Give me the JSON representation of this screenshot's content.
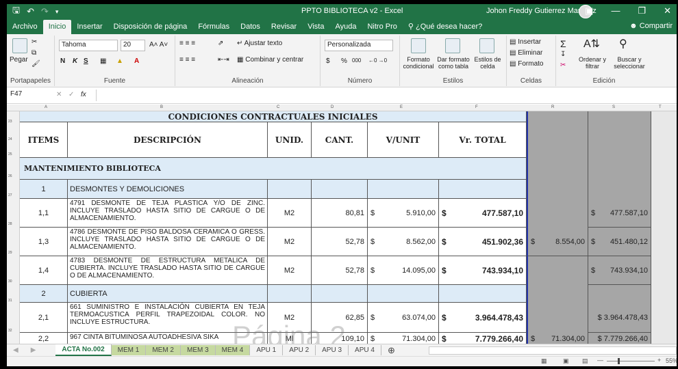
{
  "titlebar": {
    "doc_title": "PPTO BIBLIOTECA v2 - Excel",
    "user": "Johon Freddy Gutierrez Martinez"
  },
  "tabs": [
    "Archivo",
    "Inicio",
    "Insertar",
    "Disposición de página",
    "Fórmulas",
    "Datos",
    "Revisar",
    "Vista",
    "Ayuda",
    "Nitro Pro"
  ],
  "tell_me": "¿Qué desea hacer?",
  "share": "Compartir",
  "ribbon": {
    "paste": "Pegar",
    "clipboard": "Portapapeles",
    "font_name": "Tahoma",
    "font_size": "20",
    "font_group": "Fuente",
    "wrap": "Ajustar texto",
    "merge": "Combinar y centrar",
    "align_group": "Alineación",
    "number_format": "Personalizada",
    "currency": "$",
    "percent": "%",
    "thousands": "000",
    "number_group": "Número",
    "cond_format": "Formato condicional",
    "table_format": "Dar formato como tabla",
    "cell_styles": "Estilos de celda",
    "styles_group": "Estilos",
    "insert": "Insertar",
    "delete": "Eliminar",
    "format": "Formato",
    "cells_group": "Celdas",
    "sort": "Ordenar y filtrar",
    "find": "Buscar y seleccionar",
    "edit_group": "Edición"
  },
  "formula_bar": {
    "name_box": "F47",
    "fx": "fx",
    "formula": ""
  },
  "columns": [
    "A",
    "B",
    "C",
    "D",
    "E",
    "F",
    "R",
    "S",
    "T"
  ],
  "rows": [
    "23",
    "24",
    "25",
    "26",
    "27",
    "28",
    "29",
    "30",
    "31",
    "32",
    "33"
  ],
  "table": {
    "title": "CONDICIONES CONTRACTUALES INICIALES",
    "headers": {
      "items": "ITEMS",
      "desc": "DESCRIPCIÓN",
      "unid": "UNID.",
      "cant": "CANT.",
      "vunit": "V/UNIT",
      "vtotal": "Vr. TOTAL"
    },
    "section": "MANTENIMIENTO BIBLIOTECA",
    "group1": {
      "num": "1",
      "name": "DESMONTES Y DEMOLICIONES"
    },
    "group2": {
      "num": "2",
      "name": "CUBIERTA"
    },
    "rows": [
      {
        "item": "1,1",
        "desc": "4791 DESMONTE DE TEJA PLASTICA Y/O DE ZINC. INCLUYE TRASLADO HASTA SITIO DE CARGUE O DE ALMACENAMIENTO.",
        "unid": "M2",
        "cant": "80,81",
        "cur": "$",
        "vunit": "5.910,00",
        "vtotal": "477.587,10",
        "r": "",
        "s": "477.587,10"
      },
      {
        "item": "1,3",
        "desc": "4786 DESMONTE DE PISO BALDOSA CERAMICA O GRESS. INCLUYE TRASLADO HASTA SITIO DE CARGUE O DE ALMACENAMIENTO.",
        "unid": "M2",
        "cant": "52,78",
        "cur": "$",
        "vunit": "8.562,00",
        "vtotal": "451.902,36",
        "r": "8.554,00",
        "s": "451.480,12"
      },
      {
        "item": "1,4",
        "desc": "4783 DESMONTE DE ESTRUCTURA METALICA DE CUBIERTA. INCLUYE TRASLADO HASTA SITIO DE CARGUE O DE ALMACENAMIENTO.",
        "unid": "M2",
        "cant": "52,78",
        "cur": "$",
        "vunit": "14.095,00",
        "vtotal": "743.934,10",
        "r": "",
        "s": "743.934,10"
      },
      {
        "item": "2,1",
        "desc": "661 SUMINISTRO E INSTALACIÓN CUBIERTA EN TEJA TERMOACUSTICA PERFIL TRAPEZOIDAL COLOR. NO INCLUYE ESTRUCTURA.",
        "unid": "M2",
        "cant": "62,85",
        "cur": "$",
        "vunit": "63.074,00",
        "vtotal": "3.964.478,43",
        "r": "",
        "s": "$ 3.964.478,43"
      },
      {
        "item": "2,2",
        "desc": "967 CINTA BITUMINOSA AUTOADHESIVA SIKA",
        "unid": "Ml",
        "cant": "109,10",
        "cur": "$",
        "vunit": "71.304,00",
        "vtotal": "7.779.266,40",
        "r": "71.304,00",
        "s": "$ 7.779.266,40"
      }
    ]
  },
  "watermark": "Página 2",
  "sheets": [
    "ACTA No.002",
    "MEM 1",
    "MEM 2",
    "MEM 3",
    "MEM 4",
    "APU 1",
    "APU 2",
    "APU 3",
    "APU 4"
  ],
  "zoom": "55%"
}
